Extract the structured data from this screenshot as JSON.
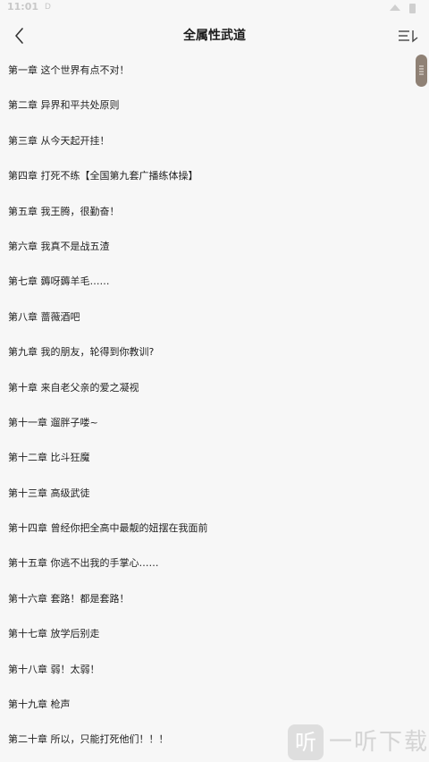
{
  "status_bar": {
    "time": "11:01",
    "indicator": "D",
    "icons": [
      "wifi-icon",
      "battery-icon"
    ]
  },
  "header": {
    "title": "全属性武道",
    "back_icon": "chevron-left-icon",
    "menu_icon": "list-order-icon"
  },
  "chapters": [
    "第一章 这个世界有点不对！",
    "第二章 异界和平共处原则",
    "第三章 从今天起开挂！",
    "第四章 打死不练【全国第九套广播练体操】",
    "第五章 我王腾，很勤奋！",
    "第六章 我真不是战五渣",
    "第七章 薅呀薅羊毛……",
    "第八章 蔷薇酒吧",
    "第九章 我的朋友，轮得到你教训?",
    "第十章 来自老父亲的爱之凝视",
    "第十一章 遛胖子喽~",
    "第十二章 比斗狂魔",
    "第十三章 高级武徒",
    "第十四章 曾经你把全高中最靓的妞摆在我面前",
    "第十五章 你逃不出我的手掌心……",
    "第十六章 套路！都是套路！",
    "第十七章 放学后别走",
    "第十八章 弱！太弱！",
    "第十九章 枪声",
    "第二十章 所以，只能打死他们！！！"
  ],
  "scrollbar": {
    "color": "#8f8175"
  },
  "watermark": {
    "badge_char": "听",
    "text": "一听下载"
  }
}
